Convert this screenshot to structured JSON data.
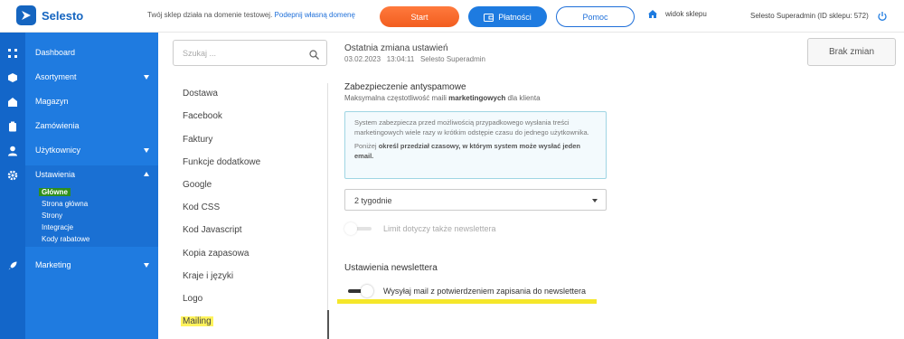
{
  "app": {
    "logo_text": "Selesto",
    "brand_color": "#1f7be0"
  },
  "topbar": {
    "notice_text": "Twój sklep działa na domenie testowej.",
    "notice_link": "Podepnij własną domenę",
    "start_label": "Start",
    "payments_label": "Płatności",
    "help_label": "Pomoc",
    "shop_view_label": "widok sklepu",
    "user_label": "Selesto Superadmin (ID sklepu: 572)"
  },
  "sidebar": {
    "items": [
      {
        "label": "Dashboard",
        "icon": "grid-icon"
      },
      {
        "label": "Asortyment",
        "icon": "box-icon",
        "expandable": true
      },
      {
        "label": "Magazyn",
        "icon": "warehouse-icon"
      },
      {
        "label": "Zamówienia",
        "icon": "clipboard-icon"
      },
      {
        "label": "Użytkownicy",
        "icon": "user-icon",
        "expandable": true
      },
      {
        "label": "Ustawienia",
        "icon": "gear-icon",
        "expanded": true
      },
      {
        "label": "Marketing",
        "icon": "rocket-icon",
        "expandable": true
      }
    ],
    "settings_sub": [
      "Główne",
      "Strona główna",
      "Strony",
      "Integracje",
      "Kody rabatowe"
    ]
  },
  "settings_list": {
    "search_placeholder": "Szukaj ...",
    "items": [
      "Dostawa",
      "Facebook",
      "Faktury",
      "Funkcje dodatkowe",
      "Google",
      "Kod CSS",
      "Kod Javascript",
      "Kopia zapasowa",
      "Kraje i języki",
      "Logo",
      "Mailing"
    ],
    "active": "Mailing"
  },
  "main": {
    "last_change_title": "Ostatnia zmiana ustawień",
    "last_change_date": "03.02.2023",
    "last_change_time": "13:04:11",
    "last_change_user": "Selesto Superadmin",
    "no_changes_label": "Brak zmian",
    "antispam": {
      "title": "Zabezpieczenie antyspamowe",
      "subtitle_pre": "Maksymalna częstotliwość maili",
      "subtitle_bold": "marketingowych",
      "subtitle_post": "dla klienta",
      "info_p1": "System zabezpiecza przed możliwością przypadkowego wysłania treści marketingowych wiele razy w krótkim odstępie czasu do jednego użytkownika.",
      "info_p2_pre": "Poniżej",
      "info_p2_bold": "określ przedział czasowy, w którym system może wysłać jeden email.",
      "select_value": "2 tygodnie",
      "toggle_label": "Limit dotyczy także newslettera",
      "toggle_on": false
    },
    "newsletter": {
      "title": "Ustawienia newslettera",
      "toggle_label": "Wysyłaj mail z potwierdzeniem zapisania do newslettera",
      "toggle_on": true
    }
  }
}
